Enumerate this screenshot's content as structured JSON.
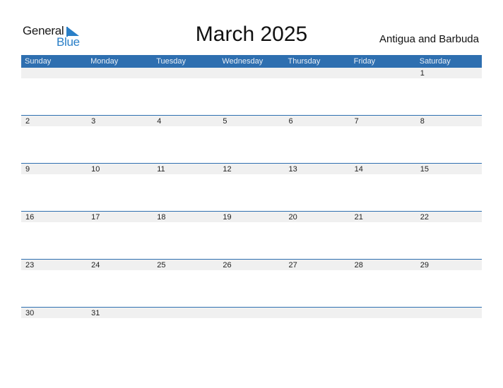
{
  "logo": {
    "word1": "General",
    "word2": "Blue"
  },
  "title": "March 2025",
  "country": "Antigua and Barbuda",
  "colors": {
    "header_bg": "#2e6fb0",
    "accent": "#2a7fc7",
    "date_bar_bg": "#f0f0f0"
  },
  "weekdays": [
    "Sunday",
    "Monday",
    "Tuesday",
    "Wednesday",
    "Thursday",
    "Friday",
    "Saturday"
  ],
  "weeks": [
    [
      "",
      "",
      "",
      "",
      "",
      "",
      "1"
    ],
    [
      "2",
      "3",
      "4",
      "5",
      "6",
      "7",
      "8"
    ],
    [
      "9",
      "10",
      "11",
      "12",
      "13",
      "14",
      "15"
    ],
    [
      "16",
      "17",
      "18",
      "19",
      "20",
      "21",
      "22"
    ],
    [
      "23",
      "24",
      "25",
      "26",
      "27",
      "28",
      "29"
    ],
    [
      "30",
      "31",
      "",
      "",
      "",
      "",
      ""
    ]
  ]
}
